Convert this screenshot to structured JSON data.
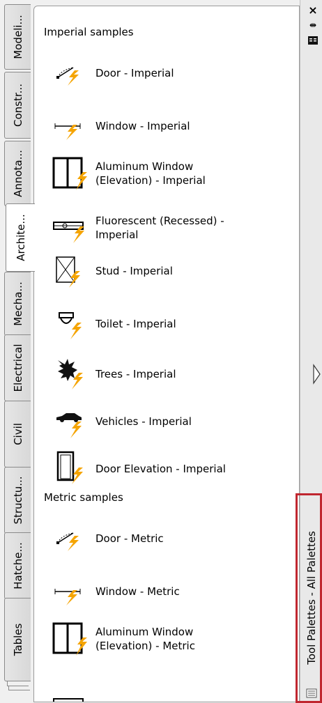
{
  "titlebar": {
    "title": "Tool Palettes - All Palettes",
    "close_label": "×",
    "autohide_label": "⇹"
  },
  "tabs": [
    {
      "label": "Modeli..."
    },
    {
      "label": "Constr..."
    },
    {
      "label": "Annota..."
    },
    {
      "label": "Archite..."
    },
    {
      "label": "Mecha..."
    },
    {
      "label": "Electrical"
    },
    {
      "label": "Civil"
    },
    {
      "label": "Structu..."
    },
    {
      "label": "Hatche..."
    },
    {
      "label": "Tables"
    }
  ],
  "active_tab": "Archite...",
  "sections": {
    "imperial": "Imperial samples",
    "metric": "Metric samples"
  },
  "tools": {
    "door_imperial": "Door - Imperial",
    "window_imperial": "Window - Imperial",
    "aluminum_imperial_1": "Aluminum Window",
    "aluminum_imperial_2": "(Elevation) - Imperial",
    "fluorescent_imperial_1": "Fluorescent (Recessed) -",
    "fluorescent_imperial_2": "Imperial",
    "stud_imperial": "Stud - Imperial",
    "toilet_imperial": "Toilet - Imperial",
    "trees_imperial": "Trees - Imperial",
    "vehicles_imperial": "Vehicles - Imperial",
    "door_elevation_imperial": "Door Elevation - Imperial",
    "door_metric": "Door - Metric",
    "window_metric": "Window - Metric",
    "aluminum_metric_1": "Aluminum Window",
    "aluminum_metric_2": "(Elevation) - Metric"
  },
  "colors": {
    "highlight": "#c0262f",
    "lightning": "#f5a400"
  }
}
